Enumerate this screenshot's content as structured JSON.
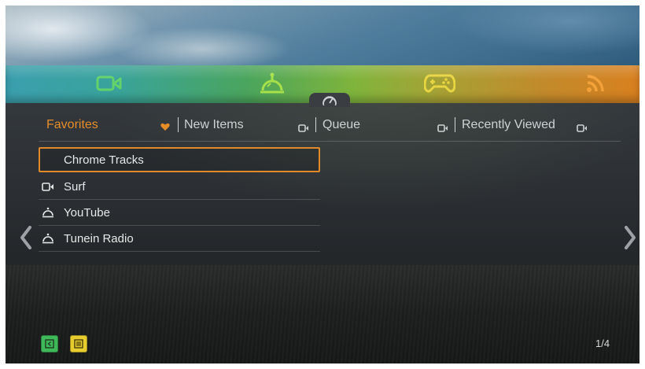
{
  "subnav": {
    "favorites": "Favorites",
    "new_items": "New Items",
    "queue": "Queue",
    "recently_viewed": "Recently Viewed"
  },
  "list": {
    "selected": "Chrome Tracks",
    "items": [
      {
        "label": "Surf",
        "icon": "video-icon"
      },
      {
        "label": "YouTube",
        "icon": "bell-icon"
      },
      {
        "label": "Tunein Radio",
        "icon": "bell-icon"
      }
    ]
  },
  "pager": "1/4",
  "colors": {
    "accent_orange": "#e08a2b",
    "video_green": "#63d26b",
    "bell_green": "#a6e04a",
    "game_yellow": "#e8d542",
    "rss_orange": "#f3a23a",
    "button_green": "#3fb85a",
    "button_yellow": "#e6cc2e"
  },
  "icons": {
    "categories": [
      "video-icon",
      "bell-icon",
      "gamepad-icon",
      "rss-icon"
    ],
    "notch": "speedometer-icon",
    "favorites_marker": "heart-icon",
    "bottom_buttons": [
      "back-icon",
      "menu-icon"
    ]
  }
}
